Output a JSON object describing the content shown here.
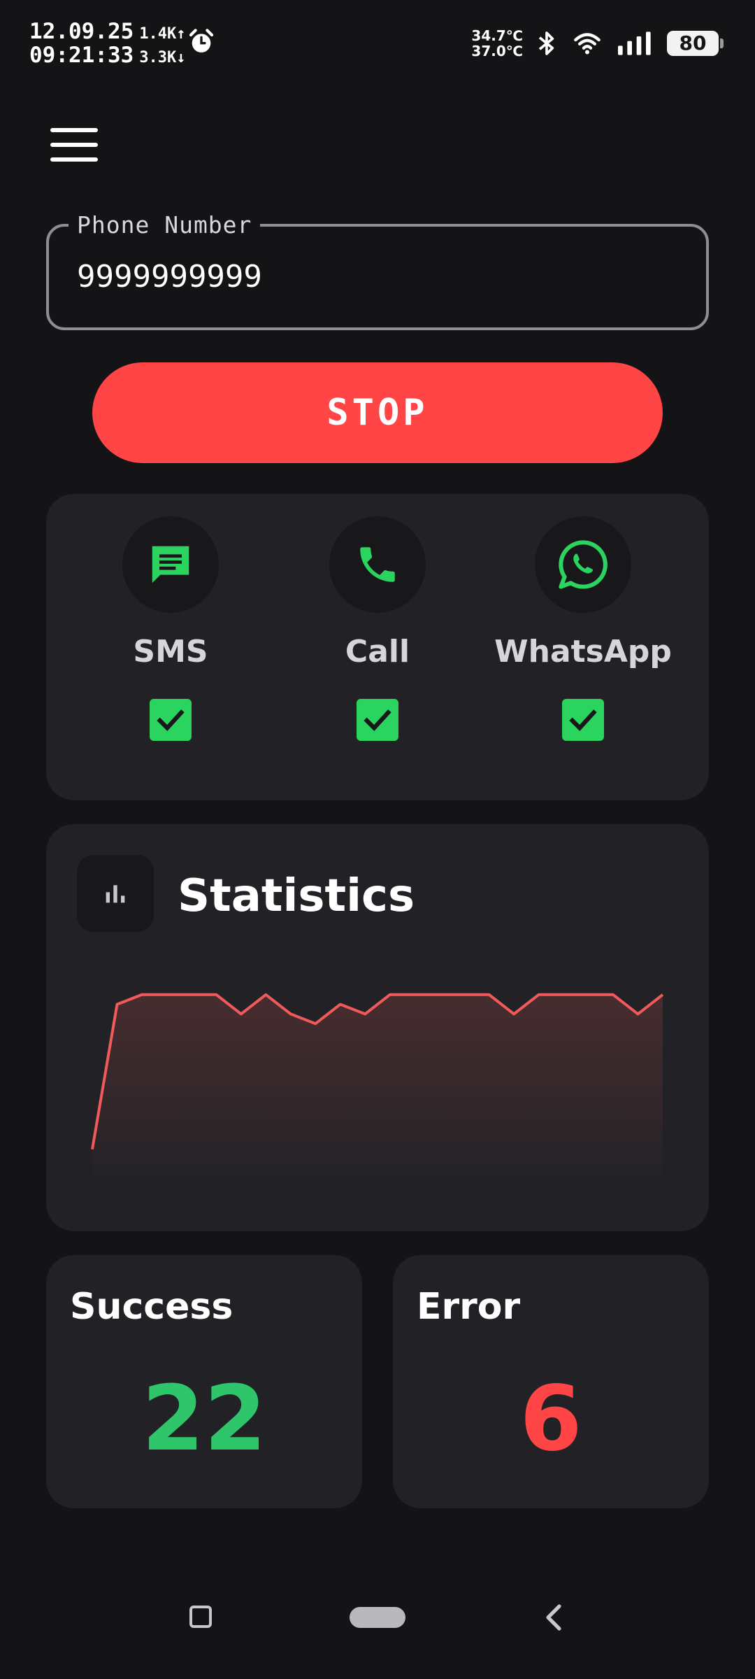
{
  "status_bar": {
    "date": "12.09.25",
    "time": "09:21:33",
    "upload_speed": "1.4K↑",
    "download_speed": "3.3K↓",
    "temp_1": "34.7℃",
    "temp_2": "37.0℃",
    "battery": "80"
  },
  "phone_field": {
    "label": "Phone Number",
    "value": "9999999999"
  },
  "stop_button": {
    "label": "STOP"
  },
  "channels": [
    {
      "label": "SMS",
      "icon": "sms-icon",
      "checked": true
    },
    {
      "label": "Call",
      "icon": "phone-icon",
      "checked": true
    },
    {
      "label": "WhatsApp",
      "icon": "whatsapp-icon",
      "checked": true
    }
  ],
  "statistics": {
    "title": "Statistics",
    "chart_data": {
      "type": "area",
      "values": [
        2,
        9.5,
        10,
        10,
        10,
        10,
        9,
        10,
        9,
        8.5,
        9.5,
        9,
        10,
        10,
        10,
        10,
        10,
        9,
        10,
        10,
        10,
        10,
        9,
        10
      ],
      "ylim": [
        0,
        10.5
      ],
      "grid": false,
      "line_color": "#f05a5a"
    }
  },
  "success": {
    "title": "Success",
    "value": "22"
  },
  "error": {
    "title": "Error",
    "value": "6"
  },
  "colors": {
    "background": "#141417",
    "card": "#222226",
    "accent_red": "#ff4545",
    "accent_green": "#2bd35f"
  }
}
